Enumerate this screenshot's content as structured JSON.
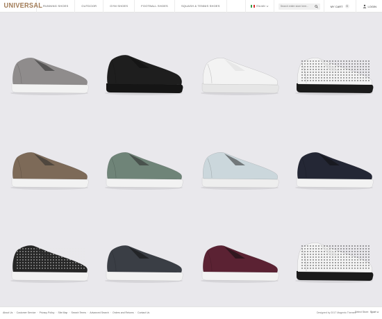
{
  "header": {
    "logo": "UNIVERSAL",
    "nav": [
      "RUNNING SHOES",
      "OUTDOOR",
      "GYM SHOES",
      "FOOTBALL SHOES",
      "SQUASH & TENNIS SHOES"
    ],
    "language": "ITALIAN",
    "search_placeholder": "Search entire store here...",
    "cart_label": "MY CART",
    "cart_count": "0",
    "login_label": "LOGIN"
  },
  "products": [
    {
      "name": "grey-suede-sneaker",
      "style": "low",
      "upper": "#8f8c8c",
      "sole": "#f2f2f2",
      "dots": false,
      "dark": false
    },
    {
      "name": "black-mid-sneaker",
      "style": "mid",
      "upper": "#1e1e1e",
      "sole": "#151515",
      "dots": false,
      "dark": true
    },
    {
      "name": "white-leather-sneaker",
      "style": "low",
      "upper": "#f3f3f3",
      "sole": "#e6e6e6",
      "dots": false,
      "dark": false
    },
    {
      "name": "white-polka-dot-sneaker",
      "style": "low",
      "upper": "#f4f4f4",
      "sole": "#1b1b1b",
      "dots": true,
      "dotColor": "#222"
    },
    {
      "name": "brown-suede-sneaker",
      "style": "low",
      "upper": "#7d6a58",
      "sole": "#f2f2f2",
      "dots": false,
      "dark": false
    },
    {
      "name": "sage-green-sneaker",
      "style": "low",
      "upper": "#6f8478",
      "sole": "#f2f2f2",
      "dots": false,
      "dark": false
    },
    {
      "name": "light-blue-sneaker",
      "style": "low",
      "upper": "#cbd7dc",
      "sole": "#eeeeee",
      "dots": false,
      "dark": false
    },
    {
      "name": "navy-woven-sneaker",
      "style": "low",
      "upper": "#242735",
      "sole": "#f2f2f2",
      "dots": false,
      "dark": true
    },
    {
      "name": "black-polka-dot-sneaker",
      "style": "low",
      "upper": "#262626",
      "sole": "#f2f2f2",
      "dots": true,
      "dotColor": "#e8e8e8"
    },
    {
      "name": "charcoal-leather-sneaker",
      "style": "low",
      "upper": "#3a3e45",
      "sole": "#f2f2f2",
      "dots": false,
      "dark": true
    },
    {
      "name": "burgundy-leather-sneaker",
      "style": "low",
      "upper": "#5b2233",
      "sole": "#f2f2f2",
      "dots": false,
      "dark": true
    },
    {
      "name": "white-polka-dot-mid-sneaker",
      "style": "mid",
      "upper": "#f4f4f4",
      "sole": "#1b1b1b",
      "dots": true,
      "dotColor": "#222"
    }
  ],
  "footer": {
    "links": [
      "About Us",
      "Customer Service",
      "Privacy Policy",
      "Site Map",
      "Search Terms",
      "Advanced Search",
      "Orders and Returns",
      "Contact Us"
    ],
    "copyright": "Designed by 2017 Magento Themes",
    "store_label": "Select Store:",
    "store_value": "Sport"
  }
}
